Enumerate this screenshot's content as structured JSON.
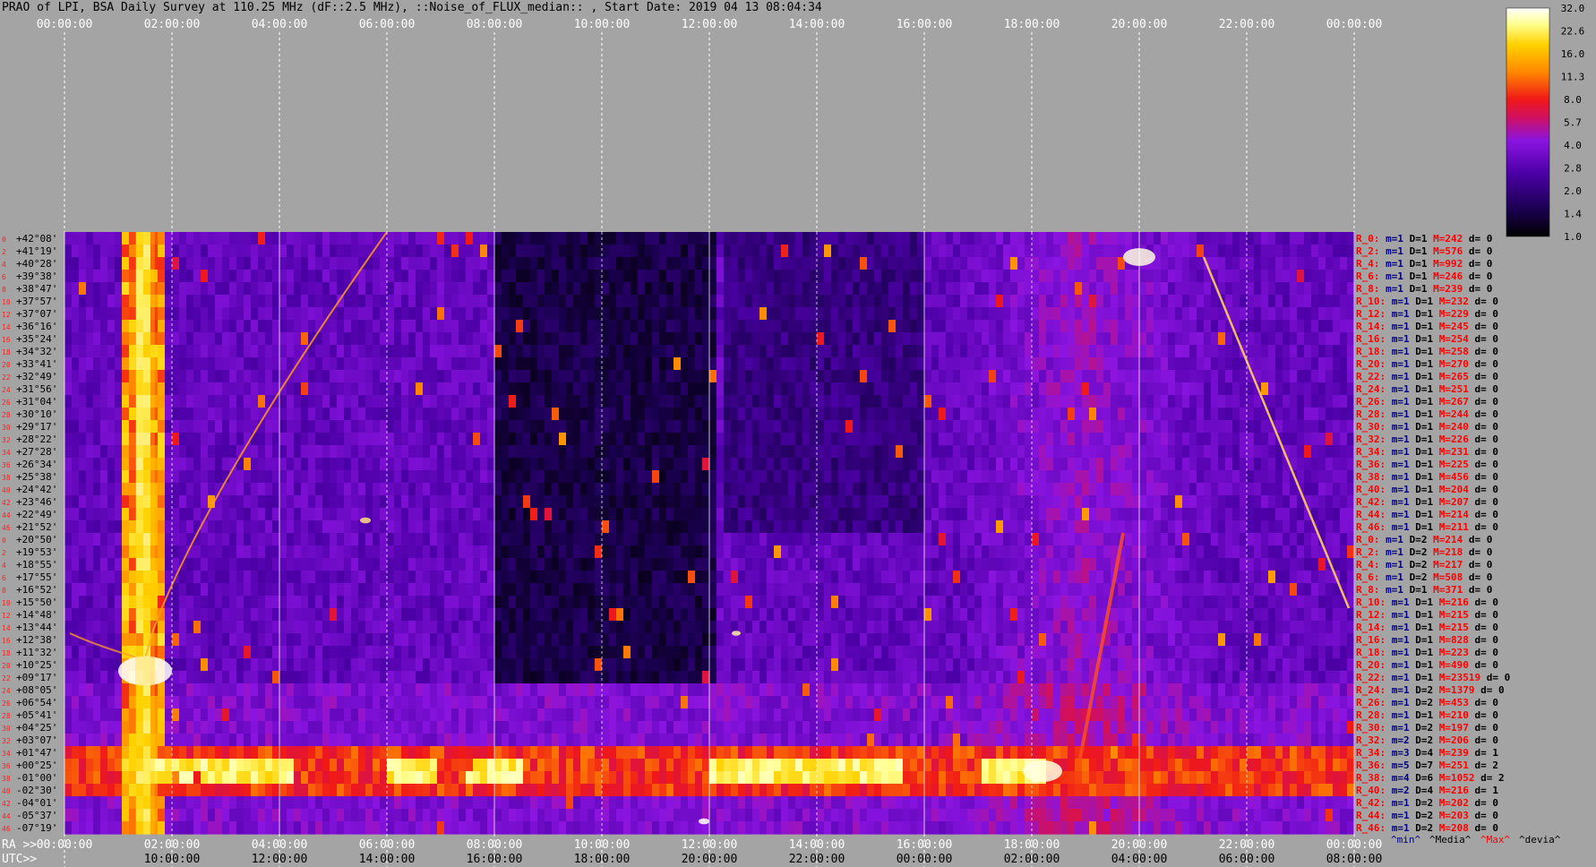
{
  "title": "PRAO of LPI, BSA Daily Survey at 110.25 MHz (dF::2.5 MHz), ::Noise_of_FLUX_median:: , Start Date: 2019 04 13 08:04:34",
  "chart_data": {
    "type": "heatmap",
    "title": "PRAO of LPI, BSA Daily Survey at 110.25 MHz (dF::2.5 MHz), ::Noise_of_FLUX_median:: , Start Date: 2019 04 13 08:04:34",
    "top_axis_ticks": [
      "00:00:00",
      "02:00:00",
      "04:00:00",
      "06:00:00",
      "08:00:00",
      "10:00:00",
      "12:00:00",
      "14:00:00",
      "16:00:00",
      "18:00:00",
      "20:00:00",
      "22:00:00",
      "00:00:00"
    ],
    "ra_label": "RA >>",
    "ra_ticks": [
      "00:00:00",
      "02:00:00",
      "04:00:00",
      "06:00:00",
      "08:00:00",
      "10:00:00",
      "12:00:00",
      "14:00:00",
      "16:00:00",
      "18:00:00",
      "20:00:00",
      "22:00:00",
      "00:00:00"
    ],
    "utc_label": "UTC>>",
    "utc_ticks": [
      "10:00:00",
      "12:00:00",
      "14:00:00",
      "16:00:00",
      "18:00:00",
      "20:00:00",
      "22:00:00",
      "00:00:00",
      "02:00:00",
      "04:00:00",
      "06:00:00",
      "08:00:00"
    ],
    "colorbar": {
      "ticks": [
        "32.0",
        "22.6",
        "16.0",
        "11.3",
        "8.0",
        "5.7",
        "4.0",
        "2.8",
        "2.0",
        "1.4",
        "1.0"
      ],
      "range": [
        1.0,
        32.0
      ],
      "scale": "log",
      "colors": [
        "#000000",
        "#1a0050",
        "#4d00a8",
        "#8a14e0",
        "#d01060",
        "#f01818",
        "#ff8800",
        "#ffd200",
        "#ffff90",
        "#ffffff"
      ]
    },
    "declinations": [
      "+42°08'",
      "+41°19'",
      "+40°28'",
      "+39°38'",
      "+38°47'",
      "+37°57'",
      "+37°07'",
      "+36°16'",
      "+35°24'",
      "+34°32'",
      "+33°41'",
      "+32°49'",
      "+31°56'",
      "+31°04'",
      "+30°10'",
      "+29°17'",
      "+28°22'",
      "+27°28'",
      "+26°34'",
      "+25°38'",
      "+24°42'",
      "+23°46'",
      "+22°49'",
      "+21°52'",
      "+20°50'",
      "+19°53'",
      "+18°55'",
      "+17°55'",
      "+16°52'",
      "+15°50'",
      "+14°48'",
      "+13°44'",
      "+12°38'",
      "+11°32'",
      "+10°25'",
      "+09°17'",
      "+08°05'",
      "+06°54'",
      "+05°41'",
      "+04°25'",
      "+03°07'",
      "+01°47'",
      "+00°25'",
      "-01°00'",
      "-02°30'",
      "-04°01'",
      "-05°37'",
      "-07°19'"
    ],
    "row_index_labels": [
      "0",
      "2",
      "4",
      "6",
      "8",
      "10",
      "12",
      "14",
      "16",
      "18",
      "20",
      "22",
      "24",
      "26",
      "28",
      "30",
      "32",
      "34",
      "36",
      "38",
      "40",
      "42",
      "44",
      "46",
      "0",
      "2",
      "4",
      "6",
      "8",
      "10",
      "12",
      "14",
      "16",
      "18",
      "20",
      "22",
      "24",
      "26",
      "28",
      "30",
      "32",
      "34",
      "36",
      "38",
      "40",
      "42",
      "44",
      "46"
    ],
    "ray_stats": [
      {
        "r": "R_0:",
        "m": "m=1",
        "d": "D=1",
        "M": "M=242",
        "dev": "d= 0"
      },
      {
        "r": "R_2:",
        "m": "m=1",
        "d": "D=1",
        "M": "M=576",
        "dev": "d= 0"
      },
      {
        "r": "R_4:",
        "m": "m=1",
        "d": "D=1",
        "M": "M=992",
        "dev": "d= 0"
      },
      {
        "r": "R_6:",
        "m": "m=1",
        "d": "D=1",
        "M": "M=246",
        "dev": "d= 0"
      },
      {
        "r": "R_8:",
        "m": "m=1",
        "d": "D=1",
        "M": "M=239",
        "dev": "d= 0"
      },
      {
        "r": "R_10:",
        "m": "m=1",
        "d": "D=1",
        "M": "M=232",
        "dev": "d= 0"
      },
      {
        "r": "R_12:",
        "m": "m=1",
        "d": "D=1",
        "M": "M=229",
        "dev": "d= 0"
      },
      {
        "r": "R_14:",
        "m": "m=1",
        "d": "D=1",
        "M": "M=245",
        "dev": "d= 0"
      },
      {
        "r": "R_16:",
        "m": "m=1",
        "d": "D=1",
        "M": "M=254",
        "dev": "d= 0"
      },
      {
        "r": "R_18:",
        "m": "m=1",
        "d": "D=1",
        "M": "M=258",
        "dev": "d= 0"
      },
      {
        "r": "R_20:",
        "m": "m=1",
        "d": "D=1",
        "M": "M=270",
        "dev": "d= 0"
      },
      {
        "r": "R_22:",
        "m": "m=1",
        "d": "D=1",
        "M": "M=265",
        "dev": "d= 0"
      },
      {
        "r": "R_24:",
        "m": "m=1",
        "d": "D=1",
        "M": "M=251",
        "dev": "d= 0"
      },
      {
        "r": "R_26:",
        "m": "m=1",
        "d": "D=1",
        "M": "M=267",
        "dev": "d= 0"
      },
      {
        "r": "R_28:",
        "m": "m=1",
        "d": "D=1",
        "M": "M=244",
        "dev": "d= 0"
      },
      {
        "r": "R_30:",
        "m": "m=1",
        "d": "D=1",
        "M": "M=240",
        "dev": "d= 0"
      },
      {
        "r": "R_32:",
        "m": "m=1",
        "d": "D=1",
        "M": "M=226",
        "dev": "d= 0"
      },
      {
        "r": "R_34:",
        "m": "m=1",
        "d": "D=1",
        "M": "M=231",
        "dev": "d= 0"
      },
      {
        "r": "R_36:",
        "m": "m=1",
        "d": "D=1",
        "M": "M=225",
        "dev": "d= 0"
      },
      {
        "r": "R_38:",
        "m": "m=1",
        "d": "D=1",
        "M": "M=456",
        "dev": "d= 0"
      },
      {
        "r": "R_40:",
        "m": "m=1",
        "d": "D=1",
        "M": "M=204",
        "dev": "d= 0"
      },
      {
        "r": "R_42:",
        "m": "m=1",
        "d": "D=1",
        "M": "M=207",
        "dev": "d= 0"
      },
      {
        "r": "R_44:",
        "m": "m=1",
        "d": "D=1",
        "M": "M=214",
        "dev": "d= 0"
      },
      {
        "r": "R_46:",
        "m": "m=1",
        "d": "D=1",
        "M": "M=211",
        "dev": "d= 0"
      },
      {
        "r": "R_0:",
        "m": "m=1",
        "d": "D=2",
        "M": "M=214",
        "dev": "d= 0"
      },
      {
        "r": "R_2:",
        "m": "m=1",
        "d": "D=2",
        "M": "M=218",
        "dev": "d= 0"
      },
      {
        "r": "R_4:",
        "m": "m=1",
        "d": "D=2",
        "M": "M=217",
        "dev": "d= 0"
      },
      {
        "r": "R_6:",
        "m": "m=1",
        "d": "D=2",
        "M": "M=508",
        "dev": "d= 0"
      },
      {
        "r": "R_8:",
        "m": "m=1",
        "d": "D=1",
        "M": "M=371",
        "dev": "d= 0"
      },
      {
        "r": "R_10:",
        "m": "m=1",
        "d": "D=1",
        "M": "M=216",
        "dev": "d= 0"
      },
      {
        "r": "R_12:",
        "m": "m=1",
        "d": "D=1",
        "M": "M=215",
        "dev": "d= 0"
      },
      {
        "r": "R_14:",
        "m": "m=1",
        "d": "D=1",
        "M": "M=215",
        "dev": "d= 0"
      },
      {
        "r": "R_16:",
        "m": "m=1",
        "d": "D=1",
        "M": "M=828",
        "dev": "d= 0"
      },
      {
        "r": "R_18:",
        "m": "m=1",
        "d": "D=1",
        "M": "M=223",
        "dev": "d= 0"
      },
      {
        "r": "R_20:",
        "m": "m=1",
        "d": "D=1",
        "M": "M=490",
        "dev": "d= 0"
      },
      {
        "r": "R_22:",
        "m": "m=1",
        "d": "D=1",
        "M": "M=23519",
        "dev": "d= 0"
      },
      {
        "r": "R_24:",
        "m": "m=1",
        "d": "D=2",
        "M": "M=1379",
        "dev": "d= 0"
      },
      {
        "r": "R_26:",
        "m": "m=1",
        "d": "D=2",
        "M": "M=453",
        "dev": "d= 0"
      },
      {
        "r": "R_28:",
        "m": "m=1",
        "d": "D=1",
        "M": "M=210",
        "dev": "d= 0"
      },
      {
        "r": "R_30:",
        "m": "m=1",
        "d": "D=2",
        "M": "M=197",
        "dev": "d= 0"
      },
      {
        "r": "R_32:",
        "m": "m=2",
        "d": "D=2",
        "M": "M=206",
        "dev": "d= 0"
      },
      {
        "r": "R_34:",
        "m": "m=3",
        "d": "D=4",
        "M": "M=239",
        "dev": "d= 1"
      },
      {
        "r": "R_36:",
        "m": "m=5",
        "d": "D=7",
        "M": "M=251",
        "dev": "d= 2"
      },
      {
        "r": "R_38:",
        "m": "m=4",
        "d": "D=6",
        "M": "M=1052",
        "dev": "d= 2"
      },
      {
        "r": "R_40:",
        "m": "m=2",
        "d": "D=4",
        "M": "M=216",
        "dev": "d= 1"
      },
      {
        "r": "R_42:",
        "m": "m=1",
        "d": "D=2",
        "M": "M=202",
        "dev": "d= 0"
      },
      {
        "r": "R_44:",
        "m": "m=1",
        "d": "D=2",
        "M": "M=203",
        "dev": "d= 0"
      },
      {
        "r": "R_46:",
        "m": "m=1",
        "d": "D=2",
        "M": "M=208",
        "dev": "d= 0"
      }
    ],
    "legend_labels": [
      {
        "text": "^min^",
        "color": "#000080"
      },
      {
        "text": "^Media^",
        "color": "#000000"
      },
      {
        "text": "^Max^",
        "color": "#ff0000"
      },
      {
        "text": "^devia^",
        "color": "#000000"
      }
    ]
  }
}
